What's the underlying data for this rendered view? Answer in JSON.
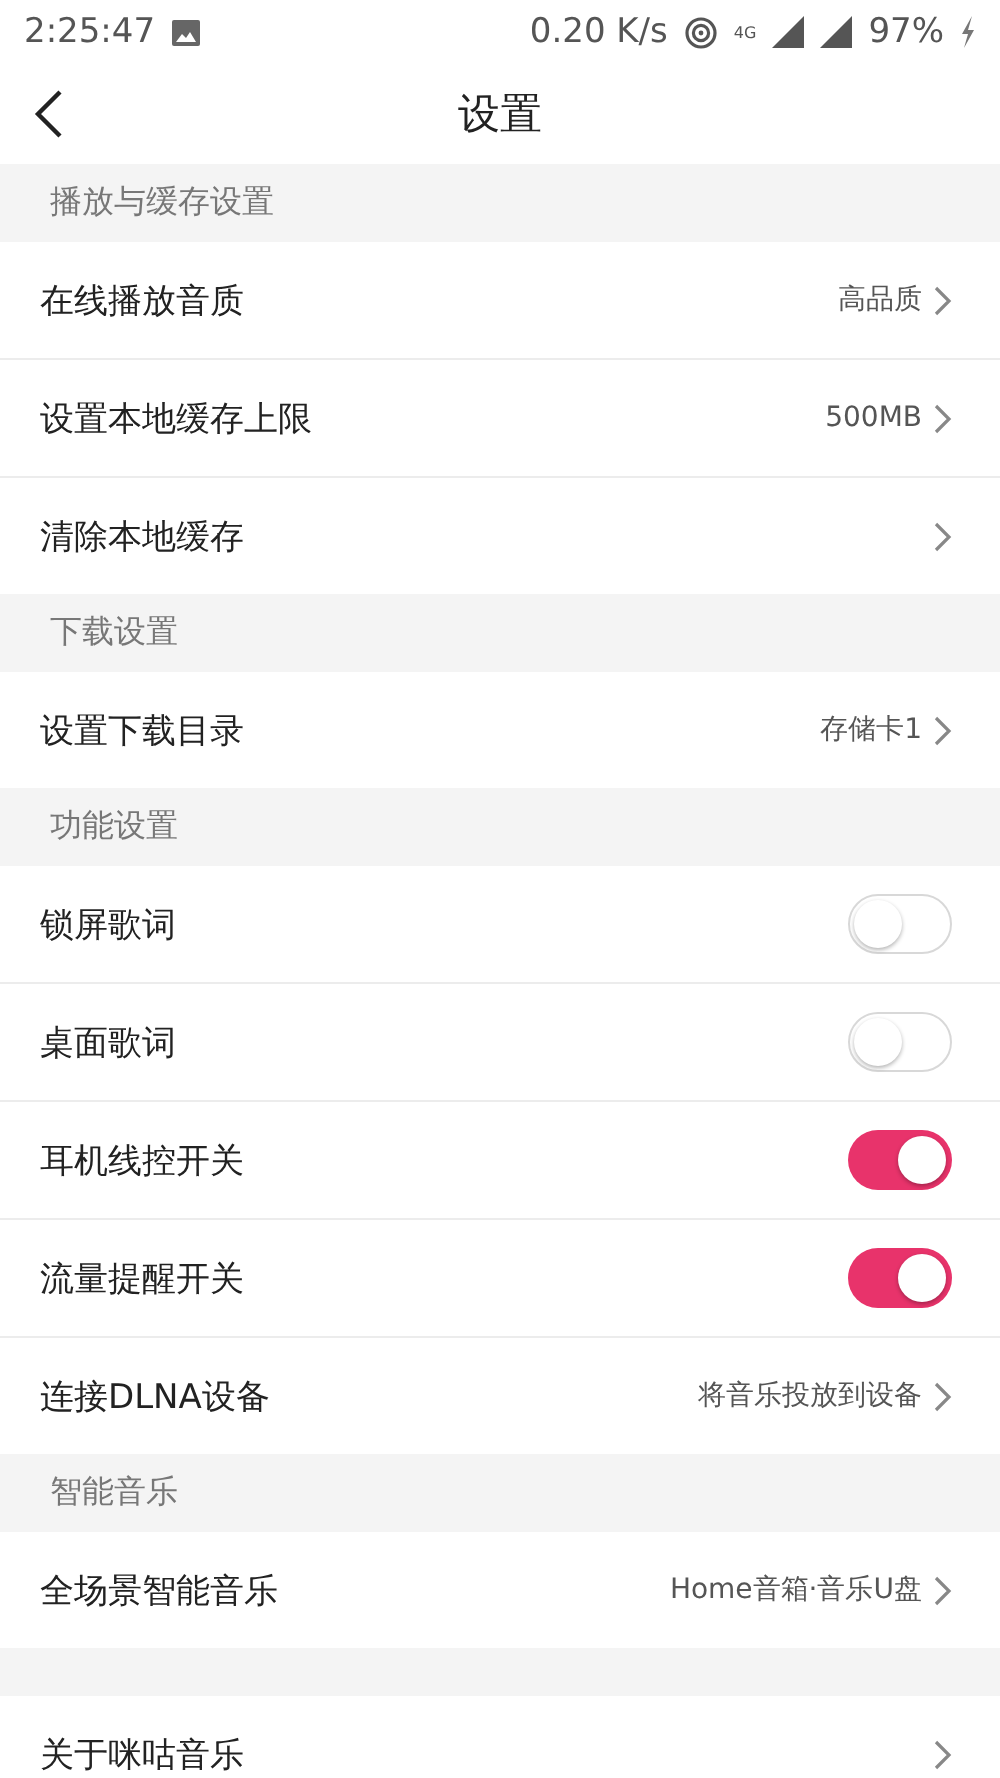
{
  "status_bar": {
    "time": "2:25:47",
    "speed": "0.20 K/s",
    "network": "4G",
    "battery": "97%"
  },
  "header": {
    "title": "设置"
  },
  "sections": [
    {
      "title": "播放与缓存设置",
      "rows": [
        {
          "kind": "link",
          "label": "在线播放音质",
          "value": "高品质"
        },
        {
          "kind": "link",
          "label": "设置本地缓存上限",
          "value": "500MB"
        },
        {
          "kind": "link",
          "label": "清除本地缓存"
        }
      ]
    },
    {
      "title": "下载设置",
      "rows": [
        {
          "kind": "link",
          "label": "设置下载目录",
          "value": "存储卡1"
        }
      ]
    },
    {
      "title": "功能设置",
      "rows": [
        {
          "kind": "toggle",
          "label": "锁屏歌词",
          "on": false
        },
        {
          "kind": "toggle",
          "label": "桌面歌词",
          "on": false
        },
        {
          "kind": "toggle",
          "label": "耳机线控开关",
          "on": true
        },
        {
          "kind": "toggle",
          "label": "流量提醒开关",
          "on": true
        },
        {
          "kind": "link",
          "label": "连接DLNA设备",
          "value": "将音乐投放到设备"
        }
      ]
    },
    {
      "title": "智能音乐",
      "rows": [
        {
          "kind": "link",
          "label": "全场景智能音乐",
          "value": "Home音箱·音乐U盘"
        }
      ]
    },
    {
      "rows": [
        {
          "kind": "link",
          "label": "关于咪咕音乐"
        }
      ]
    }
  ]
}
